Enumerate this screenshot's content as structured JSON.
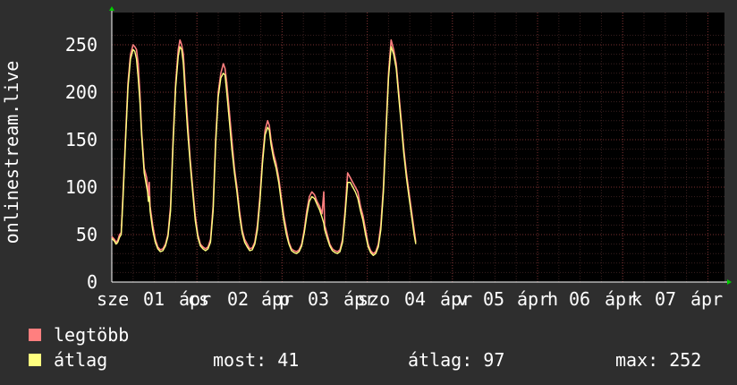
{
  "chart_data": {
    "type": "line",
    "ylabel": "onlinestream.live",
    "ylim": [
      0,
      270
    ],
    "y_ticks": [
      0,
      50,
      100,
      150,
      200,
      250
    ],
    "x_tick_labels": [
      "sze 01 ápr",
      "csü 02 ápr",
      "pén 03 ápr",
      "szo 04 ápr",
      "vas 05 ápr",
      "hét 06 ápr",
      "kedd 07 ápr"
    ],
    "x_tick_labels_visible": [
      "sze",
      "01",
      "ápr",
      "cs",
      "02",
      "ápr",
      "p",
      "03",
      "ápr",
      "szo",
      "04",
      "ápr",
      "v",
      "05",
      "ápr",
      "h",
      "06",
      "ápr",
      "k",
      "07",
      "ápr"
    ],
    "grid": true,
    "series": [
      {
        "name": "legtöbb",
        "color": "#ff7f7f",
        "points": [
          [
            0,
            48
          ],
          [
            0.03,
            45
          ],
          [
            0.05,
            42
          ],
          [
            0.07,
            44
          ],
          [
            0.09,
            50
          ],
          [
            0.11,
            52
          ],
          [
            0.13,
            90
          ],
          [
            0.16,
            150
          ],
          [
            0.19,
            210
          ],
          [
            0.22,
            240
          ],
          [
            0.25,
            250
          ],
          [
            0.27,
            248
          ],
          [
            0.29,
            245
          ],
          [
            0.31,
            230
          ],
          [
            0.33,
            200
          ],
          [
            0.35,
            160
          ],
          [
            0.38,
            120
          ],
          [
            0.41,
            110
          ],
          [
            0.42,
            100
          ],
          [
            0.43,
            90
          ],
          [
            0.44,
            105
          ],
          [
            0.45,
            80
          ],
          [
            0.48,
            60
          ],
          [
            0.51,
            45
          ],
          [
            0.54,
            37
          ],
          [
            0.57,
            34
          ],
          [
            0.6,
            35
          ],
          [
            0.63,
            40
          ],
          [
            0.66,
            50
          ],
          [
            0.69,
            80
          ],
          [
            0.72,
            150
          ],
          [
            0.75,
            210
          ],
          [
            0.78,
            245
          ],
          [
            0.8,
            255
          ],
          [
            0.82,
            250
          ],
          [
            0.84,
            240
          ],
          [
            0.86,
            210
          ],
          [
            0.89,
            170
          ],
          [
            0.92,
            130
          ],
          [
            0.95,
            100
          ],
          [
            0.98,
            70
          ],
          [
            1.01,
            50
          ],
          [
            1.04,
            40
          ],
          [
            1.07,
            37
          ],
          [
            1.1,
            35
          ],
          [
            1.13,
            37
          ],
          [
            1.16,
            45
          ],
          [
            1.19,
            80
          ],
          [
            1.22,
            150
          ],
          [
            1.25,
            200
          ],
          [
            1.28,
            220
          ],
          [
            1.31,
            230
          ],
          [
            1.33,
            225
          ],
          [
            1.35,
            210
          ],
          [
            1.38,
            180
          ],
          [
            1.41,
            150
          ],
          [
            1.44,
            120
          ],
          [
            1.47,
            100
          ],
          [
            1.5,
            75
          ],
          [
            1.53,
            55
          ],
          [
            1.56,
            45
          ],
          [
            1.59,
            40
          ],
          [
            1.62,
            35
          ],
          [
            1.65,
            36
          ],
          [
            1.68,
            42
          ],
          [
            1.71,
            60
          ],
          [
            1.74,
            90
          ],
          [
            1.77,
            130
          ],
          [
            1.8,
            160
          ],
          [
            1.83,
            170
          ],
          [
            1.85,
            165
          ],
          [
            1.87,
            150
          ],
          [
            1.9,
            135
          ],
          [
            1.93,
            125
          ],
          [
            1.96,
            110
          ],
          [
            1.99,
            90
          ],
          [
            2.02,
            70
          ],
          [
            2.05,
            55
          ],
          [
            2.08,
            42
          ],
          [
            2.11,
            35
          ],
          [
            2.14,
            33
          ],
          [
            2.17,
            32
          ],
          [
            2.2,
            34
          ],
          [
            2.23,
            40
          ],
          [
            2.26,
            55
          ],
          [
            2.29,
            75
          ],
          [
            2.32,
            90
          ],
          [
            2.35,
            95
          ],
          [
            2.38,
            92
          ],
          [
            2.41,
            85
          ],
          [
            2.44,
            80
          ],
          [
            2.47,
            72
          ],
          [
            2.49,
            95
          ],
          [
            2.5,
            60
          ],
          [
            2.53,
            50
          ],
          [
            2.56,
            40
          ],
          [
            2.59,
            35
          ],
          [
            2.62,
            33
          ],
          [
            2.65,
            32
          ],
          [
            2.68,
            34
          ],
          [
            2.71,
            45
          ],
          [
            2.74,
            75
          ],
          [
            2.77,
            115
          ],
          [
            2.8,
            110
          ],
          [
            2.83,
            105
          ],
          [
            2.86,
            100
          ],
          [
            2.89,
            95
          ],
          [
            2.92,
            80
          ],
          [
            2.95,
            70
          ],
          [
            2.98,
            55
          ],
          [
            3.01,
            40
          ],
          [
            3.04,
            33
          ],
          [
            3.07,
            30
          ],
          [
            3.1,
            32
          ],
          [
            3.13,
            40
          ],
          [
            3.16,
            60
          ],
          [
            3.19,
            100
          ],
          [
            3.22,
            160
          ],
          [
            3.25,
            220
          ],
          [
            3.28,
            255
          ],
          [
            3.31,
            245
          ],
          [
            3.34,
            230
          ],
          [
            3.37,
            200
          ],
          [
            3.4,
            170
          ],
          [
            3.43,
            140
          ],
          [
            3.46,
            115
          ],
          [
            3.49,
            95
          ],
          [
            3.52,
            75
          ],
          [
            3.55,
            55
          ],
          [
            3.57,
            42
          ]
        ]
      },
      {
        "name": "átlag",
        "color": "#ffff7f",
        "points": [
          [
            0,
            46
          ],
          [
            0.03,
            43
          ],
          [
            0.05,
            40
          ],
          [
            0.07,
            42
          ],
          [
            0.09,
            47
          ],
          [
            0.11,
            50
          ],
          [
            0.13,
            85
          ],
          [
            0.16,
            145
          ],
          [
            0.19,
            205
          ],
          [
            0.22,
            235
          ],
          [
            0.25,
            245
          ],
          [
            0.27,
            243
          ],
          [
            0.29,
            235
          ],
          [
            0.31,
            215
          ],
          [
            0.33,
            190
          ],
          [
            0.35,
            155
          ],
          [
            0.38,
            115
          ],
          [
            0.41,
            100
          ],
          [
            0.42,
            95
          ],
          [
            0.43,
            85
          ],
          [
            0.44,
            90
          ],
          [
            0.45,
            75
          ],
          [
            0.48,
            55
          ],
          [
            0.51,
            42
          ],
          [
            0.54,
            35
          ],
          [
            0.57,
            32
          ],
          [
            0.6,
            33
          ],
          [
            0.63,
            38
          ],
          [
            0.66,
            48
          ],
          [
            0.69,
            75
          ],
          [
            0.72,
            145
          ],
          [
            0.75,
            205
          ],
          [
            0.78,
            238
          ],
          [
            0.8,
            248
          ],
          [
            0.82,
            245
          ],
          [
            0.84,
            230
          ],
          [
            0.86,
            200
          ],
          [
            0.89,
            160
          ],
          [
            0.92,
            125
          ],
          [
            0.95,
            95
          ],
          [
            0.98,
            65
          ],
          [
            1.01,
            47
          ],
          [
            1.04,
            38
          ],
          [
            1.07,
            35
          ],
          [
            1.1,
            33
          ],
          [
            1.13,
            35
          ],
          [
            1.16,
            42
          ],
          [
            1.19,
            75
          ],
          [
            1.22,
            145
          ],
          [
            1.25,
            195
          ],
          [
            1.28,
            215
          ],
          [
            1.31,
            220
          ],
          [
            1.33,
            218
          ],
          [
            1.35,
            200
          ],
          [
            1.38,
            170
          ],
          [
            1.41,
            140
          ],
          [
            1.44,
            115
          ],
          [
            1.47,
            95
          ],
          [
            1.5,
            70
          ],
          [
            1.53,
            52
          ],
          [
            1.56,
            42
          ],
          [
            1.59,
            37
          ],
          [
            1.62,
            33
          ],
          [
            1.65,
            34
          ],
          [
            1.68,
            40
          ],
          [
            1.71,
            55
          ],
          [
            1.74,
            85
          ],
          [
            1.77,
            125
          ],
          [
            1.8,
            155
          ],
          [
            1.83,
            163
          ],
          [
            1.85,
            160
          ],
          [
            1.87,
            145
          ],
          [
            1.9,
            130
          ],
          [
            1.93,
            120
          ],
          [
            1.96,
            105
          ],
          [
            1.99,
            85
          ],
          [
            2.02,
            65
          ],
          [
            2.05,
            50
          ],
          [
            2.08,
            40
          ],
          [
            2.11,
            33
          ],
          [
            2.14,
            31
          ],
          [
            2.17,
            30
          ],
          [
            2.2,
            32
          ],
          [
            2.23,
            38
          ],
          [
            2.26,
            52
          ],
          [
            2.29,
            70
          ],
          [
            2.32,
            85
          ],
          [
            2.35,
            90
          ],
          [
            2.38,
            88
          ],
          [
            2.41,
            82
          ],
          [
            2.44,
            76
          ],
          [
            2.47,
            68
          ],
          [
            2.49,
            62
          ],
          [
            2.5,
            55
          ],
          [
            2.53,
            46
          ],
          [
            2.56,
            38
          ],
          [
            2.59,
            33
          ],
          [
            2.62,
            31
          ],
          [
            2.65,
            30
          ],
          [
            2.68,
            32
          ],
          [
            2.71,
            42
          ],
          [
            2.74,
            70
          ],
          [
            2.77,
            105
          ],
          [
            2.8,
            105
          ],
          [
            2.83,
            100
          ],
          [
            2.86,
            95
          ],
          [
            2.89,
            88
          ],
          [
            2.92,
            75
          ],
          [
            2.95,
            65
          ],
          [
            2.98,
            50
          ],
          [
            3.01,
            37
          ],
          [
            3.04,
            31
          ],
          [
            3.07,
            28
          ],
          [
            3.1,
            30
          ],
          [
            3.13,
            37
          ],
          [
            3.16,
            55
          ],
          [
            3.19,
            95
          ],
          [
            3.22,
            155
          ],
          [
            3.25,
            215
          ],
          [
            3.28,
            248
          ],
          [
            3.31,
            240
          ],
          [
            3.34,
            225
          ],
          [
            3.37,
            195
          ],
          [
            3.4,
            165
          ],
          [
            3.43,
            135
          ],
          [
            3.46,
            110
          ],
          [
            3.49,
            90
          ],
          [
            3.52,
            70
          ],
          [
            3.55,
            50
          ],
          [
            3.57,
            40
          ]
        ]
      }
    ]
  },
  "legend": [
    {
      "label": "legtöbb",
      "color": "#ff7f7f"
    },
    {
      "label": "átlag",
      "color": "#ffff7f"
    }
  ],
  "stats": {
    "now_label": "most:",
    "now_value": "41",
    "avg_label": "átlag:",
    "avg_value": "97",
    "max_label": "max:",
    "max_value": "252"
  }
}
